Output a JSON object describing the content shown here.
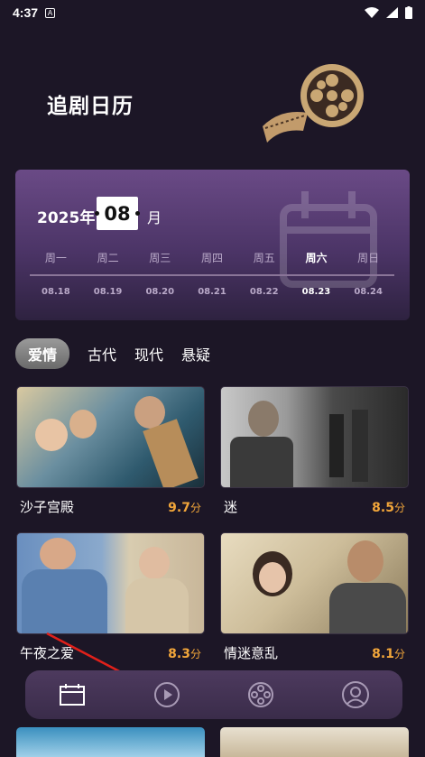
{
  "status": {
    "time": "4:37",
    "indicator": "A"
  },
  "header": {
    "title": "追剧日历"
  },
  "calendar": {
    "year": "2025年",
    "month": "08",
    "month_unit": "月",
    "weekdays": [
      "周一",
      "周二",
      "周三",
      "周四",
      "周五",
      "周六",
      "周日"
    ],
    "dates": [
      "08.18",
      "08.19",
      "08.20",
      "08.21",
      "08.22",
      "08.23",
      "08.24"
    ],
    "active_index": 5
  },
  "tabs": [
    "爱情",
    "古代",
    "现代",
    "悬疑"
  ],
  "active_tab": 0,
  "cards": [
    {
      "name": "沙子宫殿",
      "score": "9.7",
      "unit": "分"
    },
    {
      "name": "迷",
      "score": "8.5",
      "unit": "分"
    },
    {
      "name": "午夜之爱",
      "score": "8.3",
      "unit": "分"
    },
    {
      "name": "情迷意乱",
      "score": "8.1",
      "unit": "分"
    }
  ],
  "nav": [
    "calendar-icon",
    "play-icon",
    "film-reel-icon",
    "profile-icon"
  ],
  "colors": {
    "accent": "#f2a63a",
    "card_bg": "#4b3466",
    "page_bg": "#1c1626"
  }
}
